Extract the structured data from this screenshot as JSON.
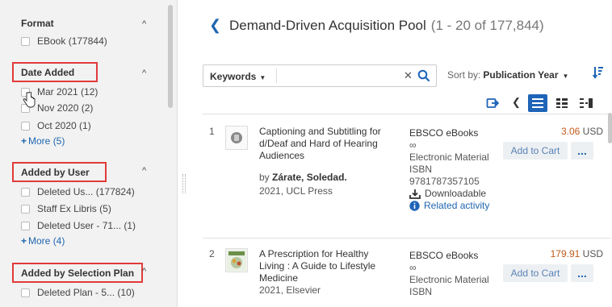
{
  "sidebar": {
    "facets": [
      {
        "title": "Format",
        "items": [
          {
            "label": "EBook",
            "count": "(177844)"
          }
        ]
      },
      {
        "title": "Date Added",
        "items": [
          {
            "label": "Mar 2021",
            "count": "(12)"
          },
          {
            "label": "Nov 2020",
            "count": "(2)"
          },
          {
            "label": "Oct 2020",
            "count": "(1)"
          }
        ],
        "more": "More (5)"
      },
      {
        "title": "Added by User",
        "items": [
          {
            "label": "Deleted Us...",
            "count": "(177824)"
          },
          {
            "label": "Staff Ex Libris",
            "count": "(5)"
          },
          {
            "label": "Deleted User - 71...",
            "count": "(1)"
          }
        ],
        "more": "More (4)"
      },
      {
        "title": "Added by Selection Plan",
        "items": [
          {
            "label": "Deleted Plan - 5...",
            "count": "(10)"
          }
        ]
      }
    ]
  },
  "header": {
    "title": "Demand-Driven Acquisition Pool",
    "count": "(1 - 20 of 177,844)"
  },
  "search": {
    "scope": "Keywords",
    "value": "",
    "sort_label": "Sort by:",
    "sort_value": "Publication Year"
  },
  "results": [
    {
      "num": "1",
      "title": "Captioning and Subtitling for d/Deaf and Hard of Hearing Audiences",
      "by": "by",
      "author": "Zárate, Soledad.",
      "pub": "2021, UCL Press",
      "provider": "EBSCO eBooks",
      "infinity": "∞",
      "material": "Electronic Material",
      "isbn_label": "ISBN",
      "isbn": "9781787357105",
      "downloadable": "Downloadable",
      "related": "Related activity",
      "price_amount": "3.06",
      "price_currency": "USD",
      "add_to_cart": "Add to Cart",
      "more": "..."
    },
    {
      "num": "2",
      "title": "A Prescription for Healthy Living : A Guide to Lifestyle Medicine",
      "pub": "2021, Elsevier",
      "provider": "EBSCO eBooks",
      "infinity": "∞",
      "material": "Electronic Material",
      "isbn_label": "ISBN",
      "price_amount": "179.91",
      "price_currency": "USD",
      "add_to_cart": "Add to Cart",
      "more": "..."
    }
  ],
  "colors": {
    "accent": "#1e64b8",
    "price": "#c05a1a",
    "highlight_box": "#e23a3a"
  }
}
